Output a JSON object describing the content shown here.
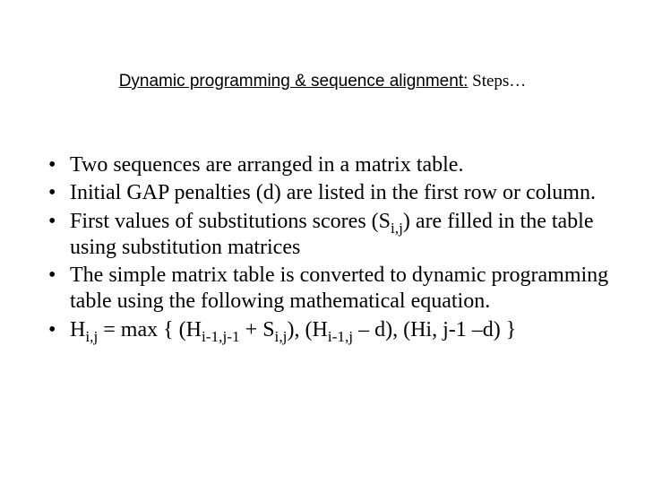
{
  "title": {
    "main": "Dynamic programming & sequence alignment:",
    "suffix": " Steps…"
  },
  "bullets": {
    "b1": "Two sequences are arranged in a matrix table.",
    "b2": "Initial GAP penalties (d) are listed in the first row or column.",
    "b3": {
      "t1": "First values of substitutions scores (S",
      "sub1": "i,j",
      "t2": ") are filled in the table using substitution matrices"
    },
    "b4": "The simple matrix table is converted to dynamic programming table using the following mathematical equation.",
    "b5": {
      "t1": "H",
      "sub1": "i,j",
      "t2": " = max { (H",
      "sub2": "i-1,j-1",
      "t3": " + S",
      "sub3": "i,j",
      "t4": "), (H",
      "sub4": "i-1,j",
      "t5": " – d), (Hi, j-1 –d) }"
    }
  }
}
